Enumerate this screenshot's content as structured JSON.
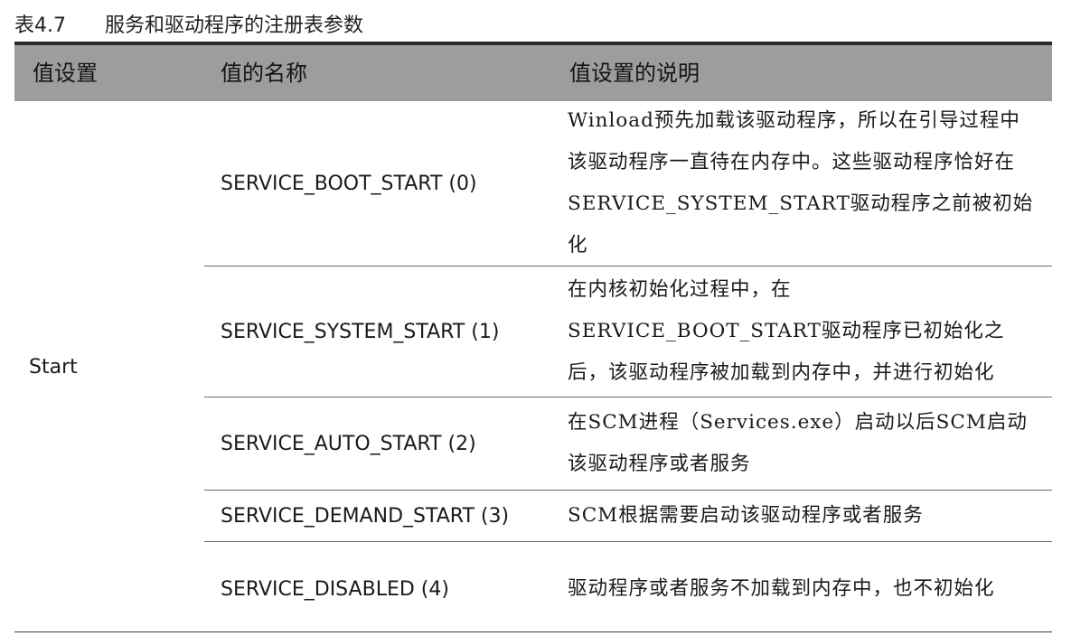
{
  "caption": {
    "number": "表4.7",
    "title": "服务和驱动程序的注册表参数"
  },
  "table": {
    "headers": [
      "值设置",
      "值的名称",
      "值设置的说明"
    ],
    "value_setting": "Start",
    "rows": [
      {
        "name": "SERVICE_BOOT_START (0)",
        "description": "Winload预先加载该驱动程序，所以在引导过程中该驱动程序一直待在内存中。这些驱动程序恰好在SERVICE_SYSTEM_START驱动程序之前被初始化"
      },
      {
        "name": "SERVICE_SYSTEM_START (1)",
        "description": "在内核初始化过程中，在SERVICE_BOOT_START驱动程序已初始化之后，该驱动程序被加载到内存中，并进行初始化"
      },
      {
        "name": "SERVICE_AUTO_START (2)",
        "description": "在SCM进程（Services.exe）启动以后SCM启动该驱动程序或者服务"
      },
      {
        "name": "SERVICE_DEMAND_START (3)",
        "description": "SCM根据需要启动该驱动程序或者服务"
      },
      {
        "name": "SERVICE_DISABLED (4)",
        "description": "驱动程序或者服务不加载到内存中，也不初始化"
      }
    ]
  },
  "colors": {
    "header_background": "#9d9d9d",
    "rule": "#2b2b2b"
  }
}
